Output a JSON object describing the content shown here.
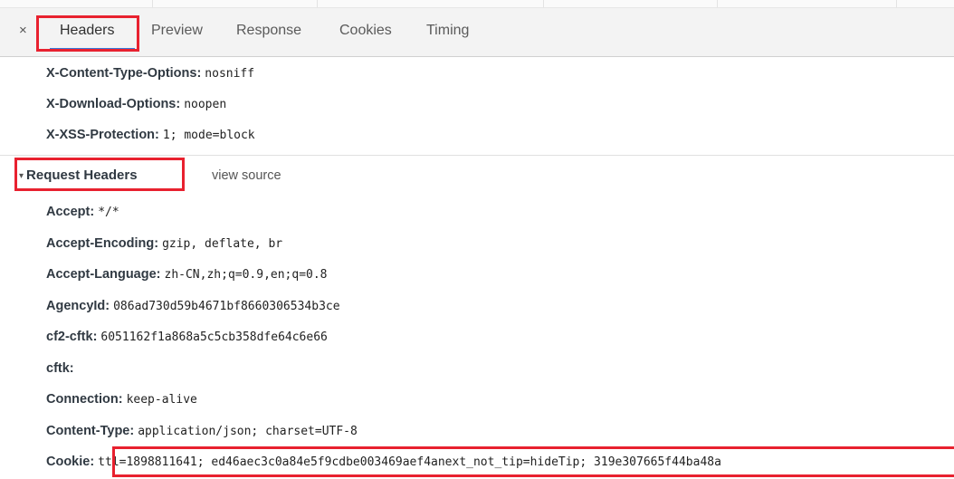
{
  "tabs": {
    "close": "×",
    "items": [
      "Headers",
      "Preview",
      "Response",
      "Cookies",
      "Timing"
    ],
    "active": "Headers"
  },
  "response_headers": [
    {
      "name": "X-Content-Type-Options:",
      "value": "nosniff"
    },
    {
      "name": "X-Download-Options:",
      "value": "noopen"
    },
    {
      "name": "X-XSS-Protection:",
      "value": "1; mode=block"
    }
  ],
  "request_section": {
    "toggle_icon": "▾",
    "title": "Request Headers",
    "view_source": "view source"
  },
  "request_headers": [
    {
      "name": "Accept:",
      "value": "*/*"
    },
    {
      "name": "Accept-Encoding:",
      "value": "gzip, deflate, br"
    },
    {
      "name": "Accept-Language:",
      "value": "zh-CN,zh;q=0.9,en;q=0.8"
    },
    {
      "name": "AgencyId:",
      "value": "086ad730d59b4671bf8660306534b3ce"
    },
    {
      "name": "cf2-cftk:",
      "value": "6051162f1a868a5c5cb358dfe64c6e66"
    },
    {
      "name": "cftk:",
      "value": ""
    },
    {
      "name": "Connection:",
      "value": "keep-alive"
    },
    {
      "name": "Content-Type:",
      "value": "application/json; charset=UTF-8"
    },
    {
      "name": "Cookie:",
      "value": "ttl=1898811641; ed46aec3c0a84e5f9cdbe003469aef4anext_not_tip=hideTip; 319e307665f44ba48a"
    }
  ],
  "colors": {
    "highlight": "#e8212f",
    "active_tab_underline": "#3879d9"
  }
}
